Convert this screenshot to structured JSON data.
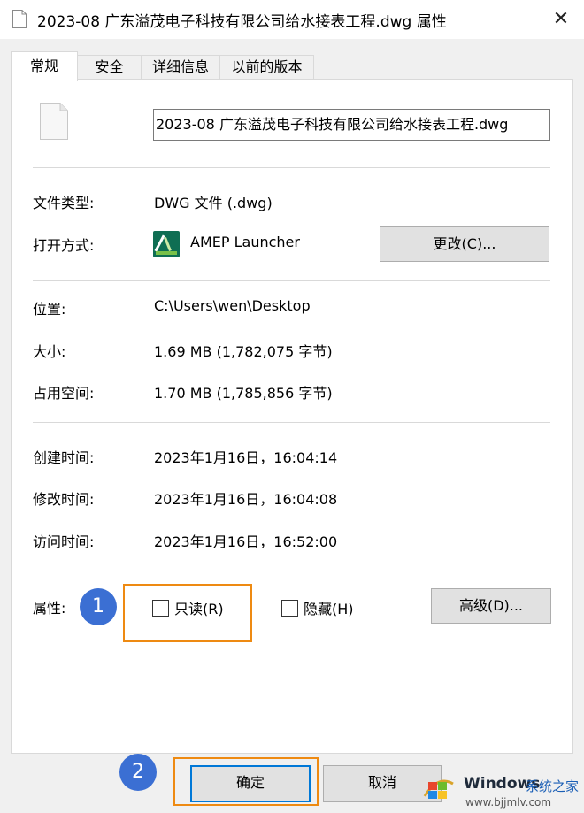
{
  "window": {
    "title": "2023-08 广东溢茂电子科技有限公司给水接表工程.dwg 属性",
    "close_glyph": "✕"
  },
  "tabs": [
    {
      "label": "常规"
    },
    {
      "label": "安全"
    },
    {
      "label": "详细信息"
    },
    {
      "label": "以前的版本"
    }
  ],
  "general": {
    "file_name": "2023-08 广东溢茂电子科技有限公司给水接表工程.dwg",
    "file_type_label": "文件类型:",
    "file_type_value": "DWG 文件 (.dwg)",
    "open_with_label": "打开方式:",
    "open_with_value": "AMEP Launcher",
    "change_button": "更改(C)...",
    "location_label": "位置:",
    "location_value": "C:\\Users\\wen\\Desktop",
    "size_label": "大小:",
    "size_value": "1.69 MB (1,782,075 字节)",
    "disk_size_label": "占用空间:",
    "disk_size_value": "1.70 MB (1,785,856 字节)",
    "created_label": "创建时间:",
    "created_value": "2023年1月16日，16:04:14",
    "modified_label": "修改时间:",
    "modified_value": "2023年1月16日，16:04:08",
    "accessed_label": "访问时间:",
    "accessed_value": "2023年1月16日，16:52:00",
    "attributes_label": "属性:",
    "readonly_label": "只读(R)",
    "readonly_checked": false,
    "hidden_label": "隐藏(H)",
    "hidden_checked": false,
    "advanced_button": "高级(D)..."
  },
  "footer": {
    "ok_button": "确定",
    "cancel_button": "取消"
  },
  "annotations": {
    "step1": "1",
    "step2": "2",
    "highlight_color": "#ee8a12",
    "marker_color": "#3b6fd3"
  },
  "watermark": {
    "windows_text": "Windows",
    "site_text": "系统之家",
    "url_text": "www.bjjmlv.com"
  }
}
